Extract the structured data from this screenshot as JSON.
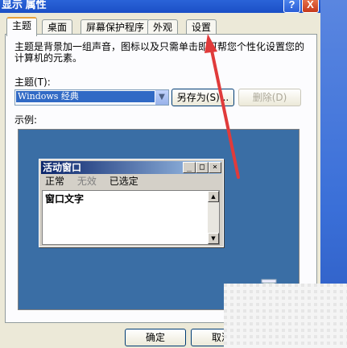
{
  "window": {
    "title": "显示 属性",
    "help_glyph": "?",
    "close_glyph": "X"
  },
  "tabs": [
    {
      "label": "主题",
      "active": true
    },
    {
      "label": "桌面"
    },
    {
      "label": "屏幕保护程序"
    },
    {
      "label": "外观"
    },
    {
      "label": "设置"
    }
  ],
  "theme_panel": {
    "description": "主题是背景加一组声音，图标以及只需单击即可帮您个性化设置您的计算机的元素。",
    "theme_label": "主题(T):",
    "theme_value": "Windows 经典",
    "save_as_label": "另存为(S)...",
    "delete_label": "删除(D)",
    "sample_label": "示例:"
  },
  "preview": {
    "window_title": "活动窗口",
    "menu": [
      "正常",
      "无效",
      "已选定"
    ],
    "window_text": "窗口文字",
    "colors": {
      "desktop": "#3a6ea5",
      "title_start": "#0a246a",
      "title_end": "#a6caf0"
    }
  },
  "buttons": {
    "ok": "确定",
    "cancel": "取消"
  },
  "annotation": {
    "color": "#e03b3b"
  }
}
